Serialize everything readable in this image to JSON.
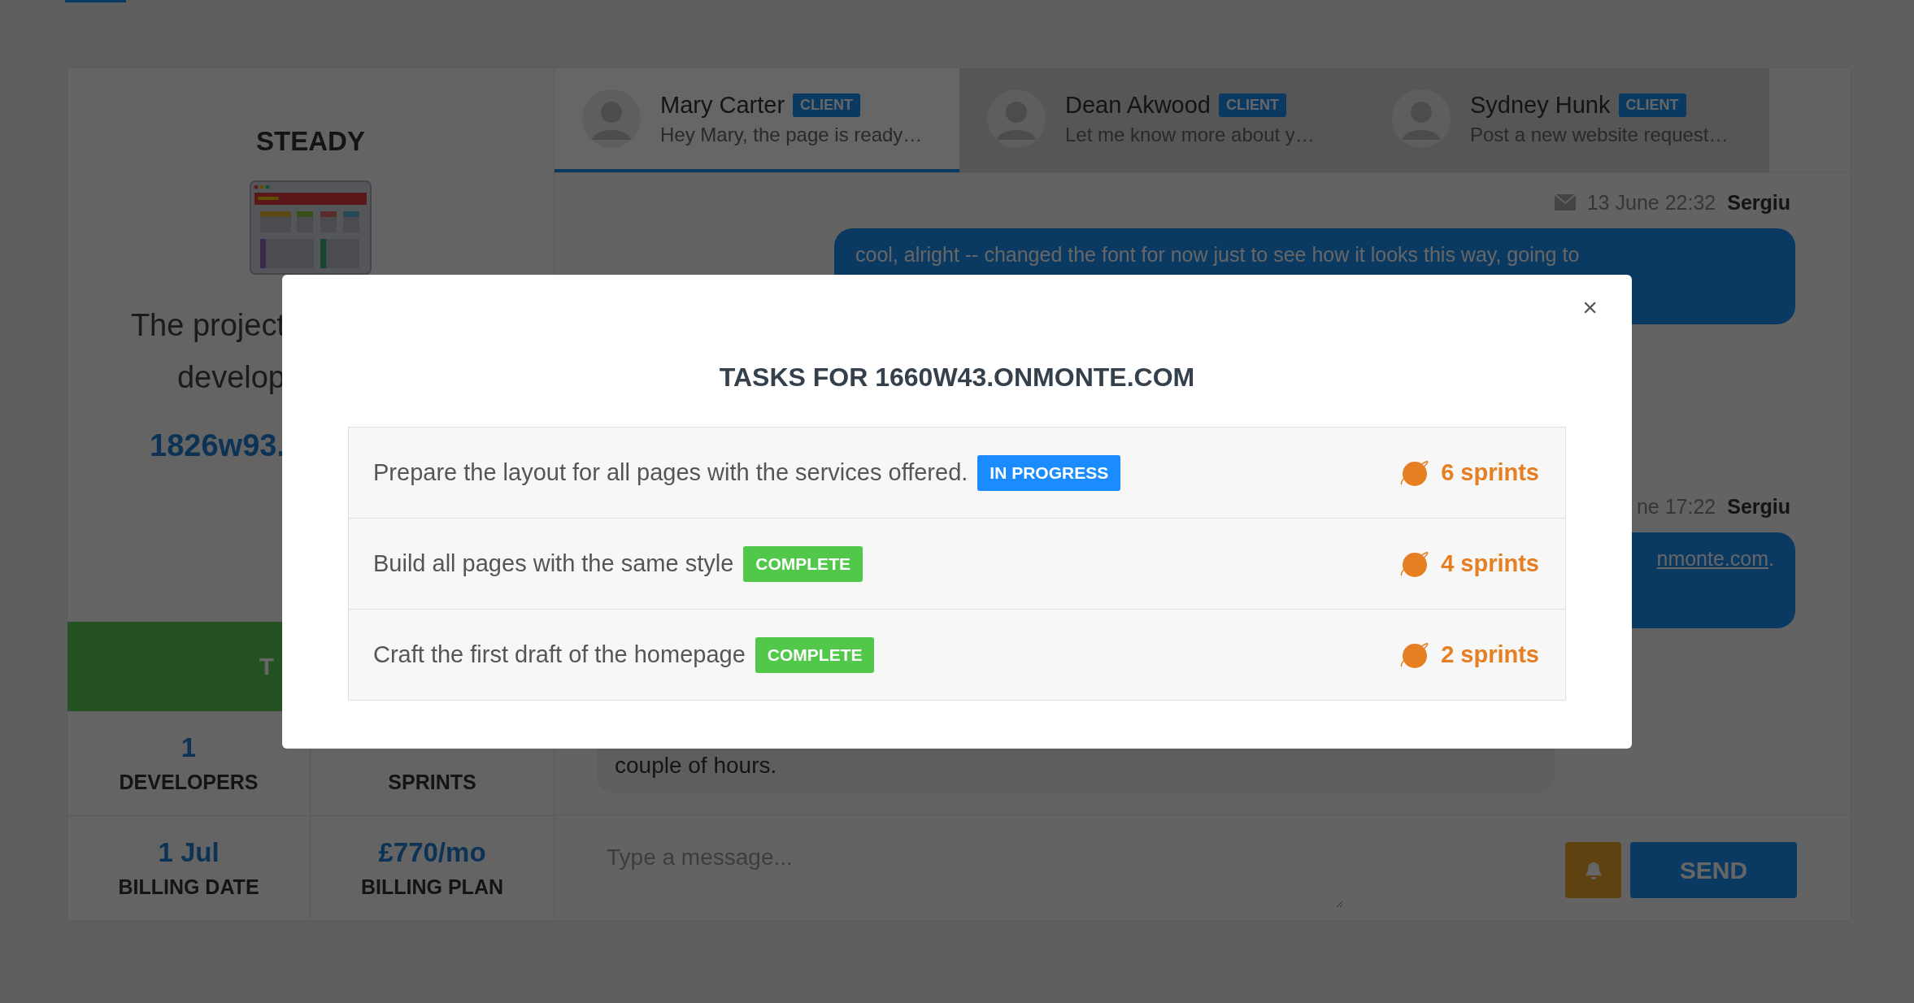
{
  "project": {
    "title": "STEADY",
    "description_lines": [
      "The project",
      "develop"
    ],
    "link": "1826w93.",
    "banner": {
      "label": "T"
    },
    "stats": [
      {
        "value": "1",
        "label": "DEVELOPERS"
      },
      {
        "label": "SPRINTS"
      },
      {
        "value": "1 Jul",
        "label": "BILLING DATE"
      },
      {
        "value": "£770/mo",
        "label": "BILLING PLAN"
      }
    ]
  },
  "chat": {
    "contacts": [
      {
        "name": "Mary Carter",
        "tag": "CLIENT",
        "preview": "Hey Mary, the page is ready…",
        "selected": true
      },
      {
        "name": "Dean Akwood",
        "tag": "CLIENT",
        "preview": "Let me know more about y…",
        "selected": false
      },
      {
        "name": "Sydney Hunk",
        "tag": "CLIENT",
        "preview": "Post a new website request…",
        "selected": false
      }
    ],
    "messages": [
      {
        "kind": "sent",
        "date": "13 June 22:32",
        "author": "Sergiu",
        "text": "cool, alright -- changed the font for now just to see how it looks this way, going to"
      },
      {
        "kind": "sent",
        "date": "ne 17:22",
        "author": "Sergiu",
        "link": "nmonte.com",
        "text": "."
      },
      {
        "kind": "received",
        "text": "couple of hours."
      }
    ],
    "composer": {
      "placeholder": "Type a message...",
      "send": "SEND"
    }
  },
  "modal": {
    "title": "TASKS FOR 1660W43.ONMONTE.COM",
    "close": "×",
    "tasks": [
      {
        "text": "Prepare the layout for all pages with the services offered.",
        "kind": "in_progress",
        "badge": "IN PROGRESS",
        "sprints": "6 sprints"
      },
      {
        "text": "Build all pages with the same style",
        "kind": "complete",
        "badge": "COMPLETE",
        "sprints": "4 sprints"
      },
      {
        "text": "Craft the first draft of the homepage",
        "kind": "complete",
        "badge": "COMPLETE",
        "sprints": "2 sprints"
      }
    ]
  }
}
